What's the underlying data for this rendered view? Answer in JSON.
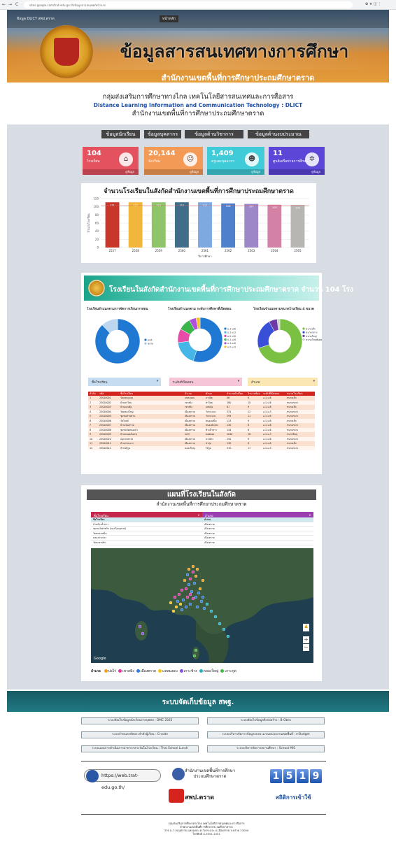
{
  "browser": {
    "url": "sites.google.com/trat-edu.go.th/ข้อมูลสารสนเทศ/หน้าแรก",
    "back": "←",
    "forward": "→",
    "reload": "C"
  },
  "banner": {
    "title": "ข้อมูลสารสนเทศทางการศึกษา",
    "subtitle": "สำนักงานเขตพื้นที่การศึกษาประถมศึกษาตราด",
    "badge": "หน้าหลัก",
    "topleft": "ข้อมูล DLICT สพป.ตราด"
  },
  "intro": {
    "group": "กลุ่มส่งเสริมการศึกษาทางไกล เทคโนโลยีสารสนเทศและการสื่อสาร",
    "english": "Distance Learning Information and Communication Technology : DLICT",
    "office": "สำนักงานเขตพื้นที่การศึกษาประถมศึกษาตราด"
  },
  "menu": [
    "ข้อมูลนักเรียน",
    "ข้อมูลบุคลากร",
    "ข้อมูลด้านวิชาการ",
    "ข้อมูลด้านงบประมาณ"
  ],
  "stats": [
    {
      "value": "104",
      "label": "โรงเรียน",
      "more": "ดูข้อมูล",
      "color": "#e4525f",
      "icon": "school-icon",
      "glyph": "⌂"
    },
    {
      "value": "20,144",
      "label": "นักเรียน",
      "more": "ดูข้อมูล",
      "color": "#f39a57",
      "icon": "student-icon",
      "glyph": "☺"
    },
    {
      "value": "1,409",
      "label": "ครูและบุคลากร",
      "more": "ดูข้อมูล",
      "color": "#3fcbd7",
      "icon": "teachers-icon",
      "glyph": "☻"
    },
    {
      "value": "11",
      "label": "ศูนย์เครือข่ายการศึกษา",
      "more": "ดูข้อมูล",
      "color": "#5b46d8",
      "icon": "network-icon",
      "glyph": "✲"
    }
  ],
  "chart_data": {
    "type": "bar",
    "title": "จำนวนโรงเรียนในสังกัดสำนักงานเขตพื้นที่การศึกษาประถมศึกษาตราด",
    "ylabel": "จำนวนโรงเรียน",
    "xlabel": "ปีการศึกษา",
    "ylim": [
      0,
      120
    ],
    "yticks": [
      "0",
      "20",
      "40",
      "60",
      "80",
      "100",
      "120"
    ],
    "categories": [
      "2557",
      "2558",
      "2559",
      "2560",
      "2561",
      "2562",
      "2563",
      "2564",
      "2565"
    ],
    "values": [
      111,
      111,
      111,
      111,
      111,
      108,
      107,
      105,
      104
    ],
    "value_labels": [
      "111",
      "111",
      "111",
      "111",
      "111",
      "108",
      "107",
      "105",
      "104"
    ],
    "colors": [
      "#c9362a",
      "#f0b73c",
      "#8fc46a",
      "#3f6d8a",
      "#7da8e0",
      "#4f80cc",
      "#9d87c9",
      "#d382a6",
      "#b7b6b3"
    ],
    "grid": true
  },
  "schools": {
    "title": "โรงเรียนในสังกัดสำนักงานเขตพื้นที่การศึกษาประถมศึกษาตราด จำนวน 104 โรง",
    "charts": [
      {
        "title": "โรงเรียนจำแนกตามการจัดการเรียนการสอน",
        "legend": [
          "ปกติ",
          "ขยาย"
        ]
      },
      {
        "title": "โรงเรียนจำแนกตาม ระดับการศึกษาที่เปิดสอน",
        "legend": [
          "อ.1-ป.6",
          "อ.1-ม.3",
          "อ.2-ป.6",
          "ป.1-ป.6",
          "อ.1-ม.6",
          "อ.2-ม.3"
        ]
      },
      {
        "title": "โรงเรียนจำแนกตามขนาดโรงเรียน 4 ขนาด",
        "legend": [
          "ขนาดเล็ก",
          "ขนาดกลาง",
          "ขนาดใหญ่",
          "ขนาดใหญ่พิเศษ"
        ]
      }
    ],
    "filters": [
      "ชื่อโรงเรียน",
      "ระดับที่เปิดสอน",
      "อำเภอ"
    ],
    "filter_colors": [
      "#c6dcf0",
      "#f6c6d8",
      "#fbe7b4"
    ],
    "columns": [
      "ลำดับ",
      "รหัส",
      "ชื่อโรงเรียน",
      "อำเภอ",
      "ตำบล",
      "จำนวนนักเรียน",
      "จำนวนห้อง",
      "ระดับที่เปิดสอน",
      "ขนาดโรงเรียน"
    ],
    "rows": [
      [
        "1",
        "23010001",
        "วัดแหลมงอบ",
        "แหลมงอบ",
        "บางปิด",
        "56",
        "8",
        "อ.1-ป.6",
        "ขนาดเล็ก"
      ],
      [
        "2",
        "23010002",
        "บ้านท่าโสม",
        "เขาสมิง",
        "ท่าโสม",
        "160",
        "10",
        "อ.1-ป.6",
        "ขนาดกลาง"
      ],
      [
        "3",
        "23010003",
        "บ้านแสนตุ้ง",
        "เขาสมิง",
        "แสนตุ้ง",
        "87",
        "9",
        "อ.1-ป.6",
        "ขนาดเล็ก"
      ],
      [
        "4",
        "23010004",
        "วัดคลองใหญ่",
        "เมืองตราด",
        "วังกระแจะ",
        "231",
        "12",
        "อ.1-ม.3",
        "ขนาดกลาง"
      ],
      [
        "5",
        "23010005",
        "ชุมชนบ้านด่าน",
        "เมืองตราด",
        "วังกระแจะ",
        "295",
        "11",
        "อ.1-ป.6",
        "ขนาดกลาง"
      ],
      [
        "6",
        "23010006",
        "วัดโบสถ์",
        "เมืองตราด",
        "หนองเสม็ด",
        "113",
        "9",
        "อ.1-ป.6",
        "ขนาดเล็ก"
      ],
      [
        "7",
        "23010007",
        "บ้านเนินทราย",
        "เมืองตราด",
        "หนองคันทรง",
        "130",
        "8",
        "อ.1-ป.6",
        "ขนาดกลาง"
      ],
      [
        "8",
        "23010008",
        "ชุมชนวัดหนองบัว",
        "เมืองตราด",
        "ห้วงน้ำขาว",
        "144",
        "8",
        "อ.1-ป.6",
        "ขนาดกลาง"
      ],
      [
        "9",
        "23010009",
        "บ้านหนองคันทรง",
        "บ่อไร่",
        "บ่อพลอย",
        "1010",
        "28",
        "อ.1-ม.3",
        "ขนาดใหญ่"
      ],
      [
        "10",
        "23010010",
        "อนุบาลตราด",
        "เมืองตราด",
        "บางพระ",
        "192",
        "9",
        "อ.1-ป.6",
        "ขนาดกลาง"
      ],
      [
        "11",
        "23010011",
        "บ้านท่าตะเภา",
        "เมืองตราด",
        "ท่ากุ่ม",
        "130",
        "8",
        "อ.1-ป.6",
        "ขนาดเล็ก"
      ],
      [
        "12",
        "23010012",
        "บ้านไม้รูด",
        "คลองใหญ่",
        "ไม้รูด",
        "370",
        "17",
        "อ.1-ม.3",
        "ขนาดกลาง"
      ]
    ]
  },
  "map": {
    "title": "แผนที่โรงเรียนในสังกัด",
    "subtitle": "สำนักงานเขตพื้นที่การศึกษาประถมศึกษาตราด",
    "dropdowns": [
      "ชื่อโรงเรียน",
      "อำเภอ"
    ],
    "columns": [
      "ชื่อโรงเรียน",
      "อำเภอ"
    ],
    "rows": [
      [
        "บ้านห้วงน้ำขาว",
        "เมืองตราด"
      ],
      [
        "ชุมชนวัดท่าพริก (ทองใบอนุสรณ์)",
        "เมืองตราด"
      ],
      [
        "วัดหนองเสม็ด",
        "เมืองตราด"
      ],
      [
        "คลองบางปรง",
        "เมืองตราด"
      ],
      [
        "วัดสะพานหิน",
        "เมืองตราด"
      ]
    ],
    "legend_label": "อำเภอ",
    "legend": [
      {
        "name": "บ่อไร่",
        "color": "#f4a21d"
      },
      {
        "name": "เขาสมิง",
        "color": "#e535ae"
      },
      {
        "name": "เมืองตราด",
        "color": "#2e7de1"
      },
      {
        "name": "แหลมงอบ",
        "color": "#f4c51d"
      },
      {
        "name": "เกาะช้าง",
        "color": "#8a4fe0"
      },
      {
        "name": "คลองใหญ่",
        "color": "#22b5c8"
      },
      {
        "name": "เกาะกูด",
        "color": "#44bb44"
      }
    ],
    "attribution": "Google"
  },
  "footer": {
    "title": "ระบบจัดเก็บข้อมูล สพฐ.",
    "links": [
      "ระบบจัดเก็บข้อมูลนักเรียนรายบุคคล : DMC 2565",
      "ระบบจัดเก็บข้อมูลสิ่งก่อสร้าง : B-Obec",
      "ระบบกำหนดรหัสประจำตัวผู้เรียน : G-code",
      "ระบบบริหารจัดการข้อมูลงบประมาณหน่วยงานเขตพื้นที่ : e-Budget",
      "ระบบแผนการดำเนินการอาหารกลางวันในโรงเรียน : Thai School Lunch",
      "ระบบบริหารจัดการสถานศึกษา : School MIS"
    ],
    "website": "https://web.trat-edu.go.th/",
    "facebook": "สำนักงานเขตพื้นที่การศึกษาประถมศึกษาตราด",
    "youtube": "สพป.ตราด",
    "counter_digits": [
      "1",
      "5",
      "1",
      "9"
    ],
    "counter_label": "สถิติการเข้าใช้",
    "address_1": "กลุ่มส่งเสริมการศึกษาทางไกล เทคโนโลยีสารสนเทศและการสื่อสาร",
    "address_2": "สำนักงานเขตพื้นที่การศึกษาประถมศึกษาตราด",
    "address_3": "376 ม.7 ถนนตราด-แหลมงอบ ต.วังกระแจะ อ.เมืองตราด จ.ตราด 23000",
    "address_4": "โทรศัพท์ 0-3951-1091"
  }
}
